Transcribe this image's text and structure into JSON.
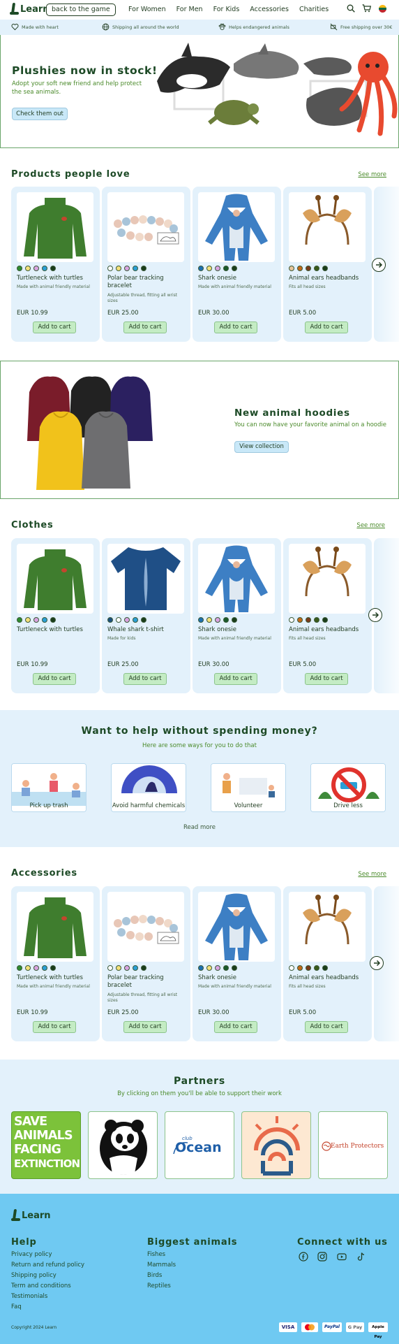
{
  "header": {
    "logo_text": "Learn",
    "back_button": "back to the game",
    "nav": [
      "For Women",
      "For Men",
      "For Kids",
      "Accessories",
      "Charities"
    ]
  },
  "strip": [
    "Made with heart",
    "Shipping all around the world",
    "Helps endangered animals",
    "Free shipping over 30€"
  ],
  "hero": {
    "title": "Plushies now in stock!",
    "subtitle": "Adopt your soft new friend and help protect the sea animals.",
    "button": "Check them out"
  },
  "products_section": {
    "title": "Products people love",
    "see_more": "See more",
    "cards": [
      {
        "name": "Turtleneck with turtles",
        "desc": "Made with animal friendly material",
        "price": "EUR 10.99",
        "add": "Add to cart"
      },
      {
        "name": "Polar bear tracking bracelet",
        "desc": "Adjustable thread, fitting all wrist sizes",
        "price": "EUR 25.00",
        "add": "Add to cart"
      },
      {
        "name": "Shark onesie",
        "desc": "Made with animal friendly material",
        "price": "EUR 30.00",
        "add": "Add to cart"
      },
      {
        "name": "Animal ears headbands",
        "desc": "Fits all head sizes",
        "price": "EUR 5.00",
        "add": "Add to cart"
      }
    ]
  },
  "banner": {
    "title": "New animal hoodies",
    "subtitle": "You can now have your favorite animal on a hoodie",
    "button": "View collection"
  },
  "clothes_section": {
    "title": "Clothes",
    "see_more": "See more",
    "cards": [
      {
        "name": "Turtleneck with turtles",
        "desc": "",
        "price": "EUR 10.99",
        "add": "Add to cart"
      },
      {
        "name": "Whale shark t-shirt",
        "desc": "Made for kids",
        "price": "EUR 25.00",
        "add": "Add to cart"
      },
      {
        "name": "Shark onesie",
        "desc": "Made with animal friendly material",
        "price": "EUR 30.00",
        "add": "Add to cart"
      },
      {
        "name": "Animal ears headbands",
        "desc": "Fits all head sizes",
        "price": "EUR 5.00",
        "add": "Add to cart"
      }
    ]
  },
  "help": {
    "title": "Want to help without spending money?",
    "subtitle": "Here are some ways for you to do that",
    "items": [
      "Pick up trash",
      "Avoid harmful chemicals",
      "Volunteer",
      "Drive less"
    ],
    "read_more": "Read more"
  },
  "accessories_section": {
    "title": "Accessories",
    "see_more": "See more",
    "cards": [
      {
        "name": "Turtleneck with turtles",
        "desc": "Made with animal friendly material",
        "price": "EUR 10.99",
        "add": "Add to cart"
      },
      {
        "name": "Polar bear tracking bracelet",
        "desc": "Adjustable thread, fitting all wrist sizes",
        "price": "EUR 25.00",
        "add": "Add to cart"
      },
      {
        "name": "Shark onesie",
        "desc": "Made with animal friendly material",
        "price": "EUR 30.00",
        "add": "Add to cart"
      },
      {
        "name": "Animal ears headbands",
        "desc": "Fits all head sizes",
        "price": "EUR 5.00",
        "add": "Add to cart"
      }
    ]
  },
  "partners": {
    "title": "Partners",
    "subtitle": "By clicking on them you'll be able to support their work",
    "save_logo": [
      "SAVE",
      "ANIMALS",
      "FACING",
      "EXTINCTION"
    ],
    "ocean_logo_small": "club",
    "ocean_logo": "Ocean",
    "earth_logo": "Earth Protectors"
  },
  "footer": {
    "logo_text": "Learn",
    "help_title": "Help",
    "help_links": [
      "Privacy policy",
      "Return and refund policy",
      "Shipping policy",
      "Term and conditions",
      "Testimonials",
      "Faq"
    ],
    "animals_title": "Biggest animals",
    "animals_links": [
      "Fishes",
      "Mammals",
      "Birds",
      "Reptiles"
    ],
    "connect_title": "Connect with us",
    "copyright": "Copyright 2024 Learn",
    "payments": [
      "VISA",
      "PayPal",
      "G Pay",
      "Apple Pay"
    ]
  },
  "colors": {
    "dark_green": "#1d4a26",
    "accent_green": "#4a8a2a",
    "light_blue": "#e3f1fb",
    "footer_blue": "#6fc9f2",
    "button_green": "#c4ecc4"
  }
}
